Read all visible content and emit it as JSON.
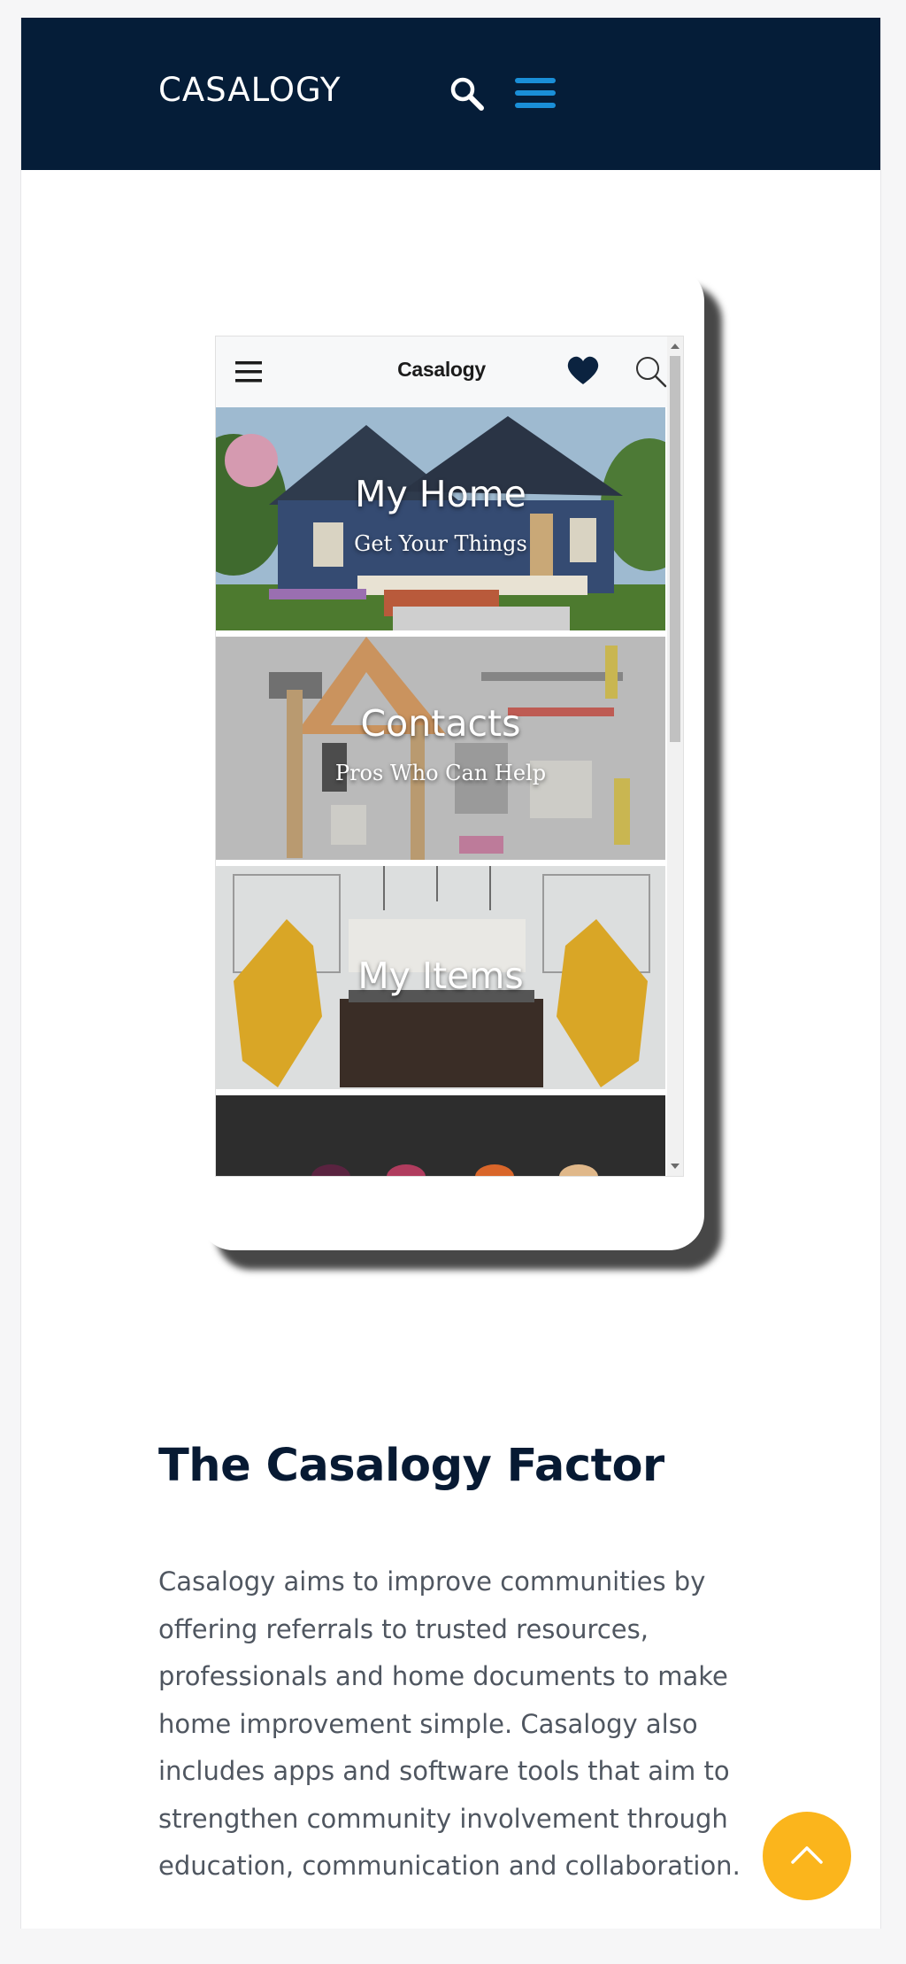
{
  "header": {
    "logo": "CASALOGY",
    "search_icon": "search-icon",
    "menu_icon": "hamburger-menu-icon",
    "background": "#051d38",
    "menu_color": "#1a8fd8"
  },
  "phone_app": {
    "title": "Casalogy",
    "menu_icon": "hamburger-menu-icon",
    "heart_icon": "heart-icon",
    "search_icon": "search-icon",
    "tiles": [
      {
        "title": "My Home",
        "subtitle": "Get Your Things"
      },
      {
        "title": "Contacts",
        "subtitle": "Pros Who Can Help"
      },
      {
        "title": "My Items",
        "subtitle": ""
      },
      {
        "title": "",
        "subtitle": ""
      }
    ]
  },
  "section": {
    "heading": "The Casalogy Factor",
    "body_lines": [
      "Casalogy aims to improve communities by",
      "offering referrals to trusted resources,",
      "professionals and home documents to make",
      "home improvement simple. Casalogy also",
      "includes apps and software tools that aim to",
      "strengthen community involvement through",
      "education, communication and collaboration."
    ]
  },
  "back_to_top": {
    "icon": "chevron-up-icon",
    "color": "#fbb51c"
  }
}
